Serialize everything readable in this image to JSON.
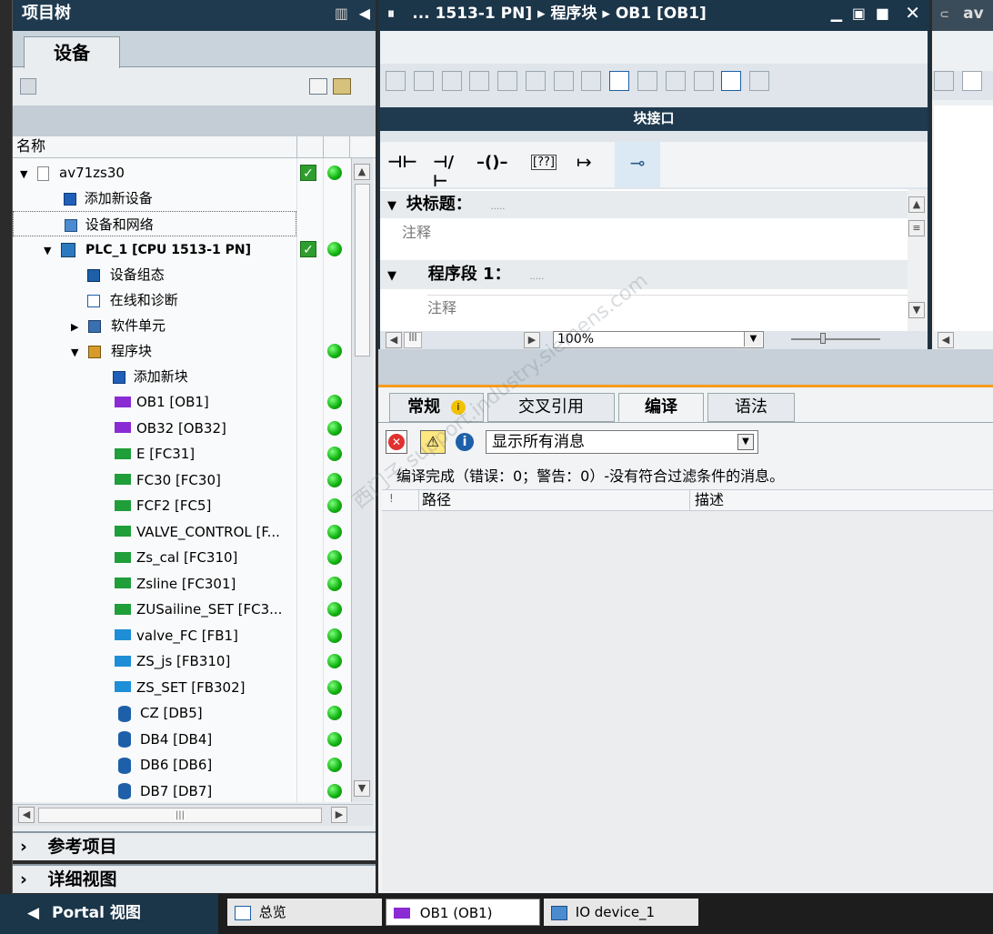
{
  "project_tree": {
    "title": "项目树",
    "devices_tab": "设备",
    "column_name": "名称",
    "items": [
      {
        "label": "av71zs30",
        "status_check": true,
        "status_dot": true
      },
      {
        "label": "添加新设备"
      },
      {
        "label": "设备和网络"
      },
      {
        "label": "PLC_1 [CPU 1513-1 PN]",
        "status_check": true,
        "status_dot": true
      },
      {
        "label": "设备组态"
      },
      {
        "label": "在线和诊断"
      },
      {
        "label": "软件单元"
      },
      {
        "label": "程序块",
        "status_dot": true
      },
      {
        "label": "添加新块"
      },
      {
        "label": "OB1 [OB1]",
        "type": "ob"
      },
      {
        "label": "OB32 [OB32]",
        "type": "ob"
      },
      {
        "label": "E [FC31]",
        "type": "fc"
      },
      {
        "label": "FC30 [FC30]",
        "type": "fc"
      },
      {
        "label": "FCF2 [FC5]",
        "type": "fc"
      },
      {
        "label": "VALVE_CONTROL [F...",
        "type": "fc"
      },
      {
        "label": "Zs_cal [FC310]",
        "type": "fc"
      },
      {
        "label": "Zsline [FC301]",
        "type": "fc"
      },
      {
        "label": "ZUSailine_SET [FC3...",
        "type": "fc"
      },
      {
        "label": "valve_FC [FB1]",
        "type": "fb"
      },
      {
        "label": "ZS_js [FB310]",
        "type": "fb"
      },
      {
        "label": "ZS_SET [FB302]",
        "type": "fb"
      },
      {
        "label": "CZ [DB5]",
        "type": "db"
      },
      {
        "label": "DB4 [DB4]",
        "type": "db"
      },
      {
        "label": "DB6 [DB6]",
        "type": "db"
      },
      {
        "label": "DB7 [DB7]",
        "type": "db"
      }
    ],
    "reference_projects": "参考项目",
    "details_view": "详细视图"
  },
  "editor": {
    "breadcrumb": "... 1513-1 PN] ▸ 程序块 ▸ OB1 [OB1]",
    "interface_label": "块接口",
    "block_title_label": "块标题：",
    "block_title_dots": ".....",
    "block_comment": "注释",
    "network_label": "程序段 1：",
    "network_dots": ".....",
    "network_comment": "注释",
    "zoom": "100%",
    "ladder_symbols": [
      "⊣⊢",
      "⊣/⊢",
      "–()–",
      "[??]",
      "↦",
      "⊸"
    ]
  },
  "right_editor": {
    "title": "av"
  },
  "inspector": {
    "tabs": [
      "常规",
      "交叉引用",
      "编译",
      "语法"
    ],
    "active_tab": "编译",
    "filter_value": "显示所有消息",
    "compile_message": "编译完成（错误：0；警告：0）-没有符合过滤条件的消息。",
    "col_mark": "!",
    "col_path": "路径",
    "col_desc": "描述"
  },
  "statusbar": {
    "portal_view": "Portal 视图",
    "tasks": [
      "总览",
      "OB1 (OB1)",
      "IO device_1"
    ]
  },
  "watermark": "西门子 support.industry.siemens.com"
}
